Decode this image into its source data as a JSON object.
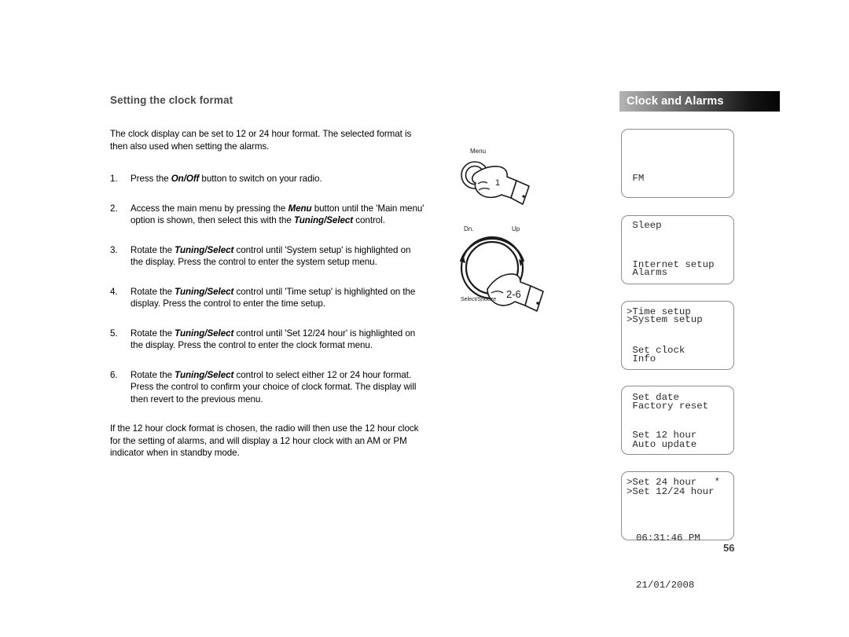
{
  "heading": "Setting the clock format",
  "intro_paragraph": "The clock display can be set to 12 or 24 hour format.  The selected format is then also used when setting the alarms.",
  "steps": [
    {
      "number": "1.",
      "html": "Press the <b>On/Off</b> button to switch on your radio."
    },
    {
      "number": "2.",
      "html": "Access the main menu by pressing the <b>Menu</b> button until the 'Main menu' option is shown, then select this with the <b>Tuning/Select</b> control."
    },
    {
      "number": "3.",
      "html": "Rotate the <b>Tuning/Select</b> control until 'System setup' is highlighted on the display. Press the control to enter the system setup menu."
    },
    {
      "number": "4.",
      "html": "Rotate the <b>Tuning/Select</b> control until 'Time setup' is highlighted on the display. Press the control to enter the time setup."
    },
    {
      "number": "5.",
      "html": "Rotate the <b>Tuning/Select</b> control until 'Set 12/24 hour' is highlighted on the display. Press the control to enter the clock format menu."
    },
    {
      "number": "6.",
      "html": "Rotate the <b>Tuning/Select</b> control to select either 12 or 24 hour format. Press the control to confirm your choice of clock format. The display will then revert to the previous menu."
    }
  ],
  "closing_paragraph": "If the 12 hour clock format is chosen, the radio will then use the 12 hour clock for the setting of alarms, and will display a 12 hour clock with an AM or PM indicator when in standby mode.",
  "illustrations": {
    "menu_button": {
      "button_label": "Menu",
      "step_ref": "1"
    },
    "rotary_knob": {
      "down_label": "Dn.",
      "up_label": "Up",
      "select_label": "Select/Snooze",
      "step_ref": "2-6"
    }
  },
  "section_banner": {
    "title": "Clock and Alarms",
    "gradient_start": "#b4b4b4",
    "gradient_end": "#050505"
  },
  "lcd_screens": [
    {
      "name": "main-menu",
      "lines": [
        " FM",
        " Sleep",
        " Alarms",
        ">System setup"
      ]
    },
    {
      "name": "system-setup",
      "lines": [
        " Internet setup",
        ">Time setup",
        " Info",
        " Factory reset"
      ]
    },
    {
      "name": "time-setup",
      "lines": [
        " Set clock",
        " Set date",
        " Auto update",
        ">Set 12/24 hour"
      ]
    },
    {
      "name": "hour-format",
      "lines": [
        " Set 12 hour",
        ">Set 24 hour   *",
        "",
        ""
      ]
    },
    {
      "name": "clock-display",
      "lines": [
        "06:31:46 PM",
        "21/01/2008"
      ]
    }
  ],
  "page_number": "56"
}
